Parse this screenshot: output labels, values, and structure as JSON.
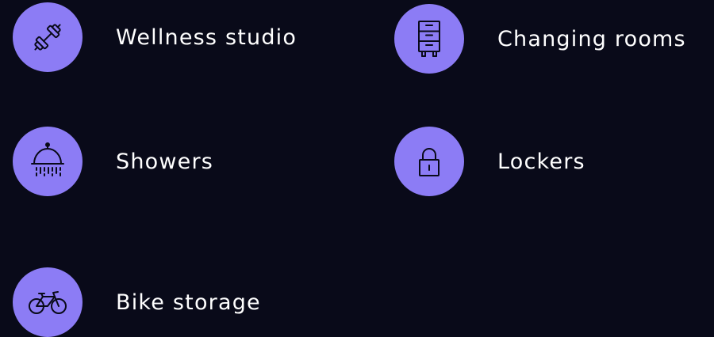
{
  "theme": {
    "background": "#090a19",
    "icon_circle": "#8c7cf5",
    "icon_stroke": "#090a19",
    "text": "#ffffff"
  },
  "amenities": [
    {
      "label": "Wellness studio",
      "icon": "dumbbell-icon"
    },
    {
      "label": "Changing rooms",
      "icon": "cabinet-icon"
    },
    {
      "label": "Showers",
      "icon": "shower-icon"
    },
    {
      "label": "Lockers",
      "icon": "padlock-icon"
    },
    {
      "label": "Bike storage",
      "icon": "bicycle-icon"
    }
  ]
}
